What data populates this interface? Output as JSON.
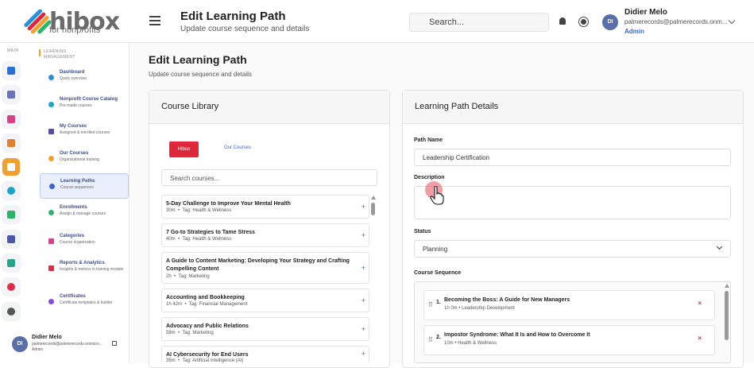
{
  "brand": {
    "name": "hibox",
    "sub": "for nonprofits"
  },
  "header": {
    "title": "Edit Learning Path",
    "subtitle": "Update course sequence and details",
    "search_placeholder": "Search...",
    "user": {
      "initials": "DI",
      "name": "Didier Melo",
      "email": "palmerecords@palmerecords.onm...",
      "role": "Admin"
    }
  },
  "rail": {
    "label": "MAIN"
  },
  "sidebar": {
    "header": "LEARNING MANAGEMENT",
    "items": [
      {
        "title": "Dashboard",
        "sub": "Quick overview"
      },
      {
        "title": "Nonprofit Course Catalog",
        "sub": "Pre-made courses"
      },
      {
        "title": "My Courses",
        "sub": "Assigned & enrolled courses"
      },
      {
        "title": "Our Courses",
        "sub": "Organizational training"
      },
      {
        "title": "Learning Paths",
        "sub": "Course sequences"
      },
      {
        "title": "Enrollments",
        "sub": "Assign & manage courses"
      },
      {
        "title": "Categories",
        "sub": "Course organization"
      },
      {
        "title": "Reports & Analytics",
        "sub": "Insights & metrics in training module"
      },
      {
        "title": "Certificates",
        "sub": "Certificate templates & builder"
      }
    ],
    "user": {
      "initials": "DI",
      "name": "Didier Melo",
      "email": "palmerecords@palmerecords.onmicro...",
      "role": "Admin"
    }
  },
  "page": {
    "title": "Edit Learning Path",
    "subtitle": "Update course sequence and details"
  },
  "library": {
    "title": "Course Library",
    "tabs": [
      "Hibox",
      "Our Courses"
    ],
    "search_placeholder": "Search courses...",
    "courses": [
      {
        "title": "5-Day Challenge to Improve Your Mental Health",
        "duration": "30m",
        "tag": "Tag: Health & Wellness"
      },
      {
        "title": "7 Go-to Strategies to Tame Stress",
        "duration": "40m",
        "tag": "Tag: Health & Wellness"
      },
      {
        "title": "A Guide to Content Marketing: Developing Your Strategy and Crafting Compelling Content",
        "duration": "2h",
        "tag": "Tag: Marketing"
      },
      {
        "title": "Accounting and Bookkeeping",
        "duration": "1h 42m",
        "tag": "Tag: Financial Management"
      },
      {
        "title": "Advocacy and Public Relations",
        "duration": "58m",
        "tag": "Tag: Marketing"
      },
      {
        "title": "AI Cybersecurity for End Users",
        "duration": "35m",
        "tag": "Tag: Artificial Intelligence (AI)"
      }
    ]
  },
  "details": {
    "title": "Learning Path Details",
    "path_name_label": "Path Name",
    "path_name_value": "Leadership Certification",
    "description_label": "Description",
    "status_label": "Status",
    "status_value": "Planning",
    "sequence_label": "Course Sequence",
    "sequence": [
      {
        "num": "1.",
        "title": "Becoming the Boss: A Guide for New Managers",
        "meta": "1h 0m • Leadership Development"
      },
      {
        "num": "2.",
        "title": "Impostor Syndrome: What It Is and How to Overcome It",
        "meta": "10m • Health & Wellness"
      }
    ]
  },
  "colors": {
    "accent": "#e0283c",
    "link": "#3a67c9"
  }
}
